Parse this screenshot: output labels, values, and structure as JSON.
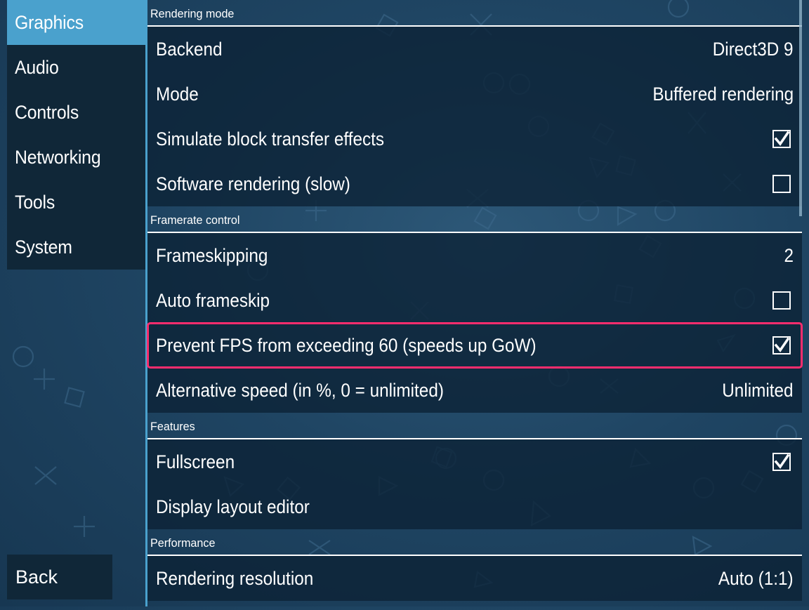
{
  "tabs": [
    {
      "label": "Graphics",
      "active": true
    },
    {
      "label": "Audio"
    },
    {
      "label": "Controls"
    },
    {
      "label": "Networking"
    },
    {
      "label": "Tools"
    },
    {
      "label": "System"
    }
  ],
  "back_label": "Back",
  "sections": {
    "rendering_mode": {
      "title": "Rendering mode",
      "backend": {
        "label": "Backend",
        "value": "Direct3D 9"
      },
      "mode": {
        "label": "Mode",
        "value": "Buffered rendering"
      },
      "block_transfer": {
        "label": "Simulate block transfer effects",
        "checked": true
      },
      "software_rendering": {
        "label": "Software rendering (slow)",
        "checked": false
      }
    },
    "framerate_control": {
      "title": "Framerate control",
      "frameskipping": {
        "label": "Frameskipping",
        "value": "2"
      },
      "auto_frameskip": {
        "label": "Auto frameskip",
        "checked": false
      },
      "prevent_fps": {
        "label": "Prevent FPS from exceeding 60 (speeds up GoW)",
        "checked": true
      },
      "alt_speed": {
        "label": "Alternative speed (in %, 0 = unlimited)",
        "value": "Unlimited"
      }
    },
    "features": {
      "title": "Features",
      "fullscreen": {
        "label": "Fullscreen",
        "checked": true
      },
      "layout_editor": {
        "label": "Display layout editor"
      }
    },
    "performance": {
      "title": "Performance",
      "rendering_resolution": {
        "label": "Rendering resolution",
        "value": "Auto (1:1)"
      }
    }
  },
  "colors": {
    "accent": "#4aa1cd",
    "highlight": "#ff2d6e",
    "tab_bg": "#102738"
  }
}
